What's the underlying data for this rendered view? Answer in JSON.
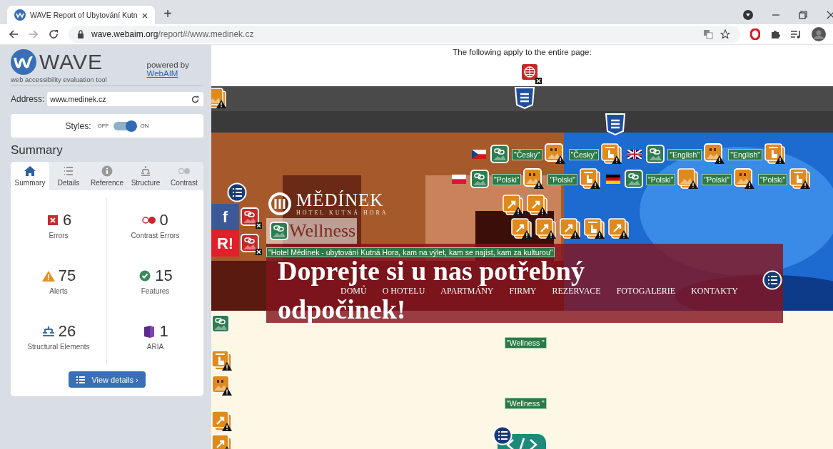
{
  "browser": {
    "tab": {
      "title": "WAVE Report of Ubytování Kutn",
      "close": "×"
    },
    "new_tab": "+",
    "url": {
      "host": "wave.webaim.org",
      "path": "/report#/www.medinek.cz"
    }
  },
  "sidebar": {
    "logo": "WAVE",
    "tagline": "web accessibility evaluation tool",
    "powered_by": "powered by",
    "powered_link": "WebAIM",
    "address_label": "Address:",
    "address_value": "www.medinek.cz",
    "styles": {
      "label": "Styles:",
      "off": "OFF",
      "on_label": "ON",
      "on": true
    },
    "summary_title": "Summary",
    "tabs": [
      {
        "label": "Summary",
        "kind": "home",
        "selected": true
      },
      {
        "label": "Details",
        "kind": "list",
        "selected": false
      },
      {
        "label": "Reference",
        "kind": "info",
        "selected": false
      },
      {
        "label": "Structure",
        "kind": "tree",
        "selected": false
      },
      {
        "label": "Contrast",
        "kind": "contrast",
        "selected": false
      }
    ],
    "stats": [
      {
        "kind": "errors",
        "count": "6",
        "label": "Errors"
      },
      {
        "kind": "contrast",
        "count": "0",
        "label": "Contrast Errors"
      },
      {
        "kind": "alerts",
        "count": "75",
        "label": "Alerts"
      },
      {
        "kind": "features",
        "count": "15",
        "label": "Features"
      },
      {
        "kind": "structure",
        "count": "26",
        "label": "Structural Elements"
      },
      {
        "kind": "aria",
        "count": "1",
        "label": "ARIA"
      }
    ],
    "view_details": "View details ›"
  },
  "page": {
    "notice": "The following apply to the entire page:",
    "page_markers": [
      {
        "kind": "error-language"
      }
    ],
    "strip_markers": [
      {
        "kind": "alert-image"
      },
      {
        "kind": "landmark"
      }
    ],
    "hero_markers": [
      {
        "kind": "landmark"
      },
      {
        "kind": "list"
      },
      {
        "kind": "error-link"
      },
      {
        "kind": "error-link"
      },
      {
        "kind": "list"
      }
    ],
    "social": [
      {
        "kind": "facebook",
        "text": "f"
      },
      {
        "kind": "rating",
        "text": "R!"
      }
    ],
    "logo": {
      "name": "MĚDÍNEK",
      "subtitle": "HOTEL KUTNÁ HORA"
    },
    "wellness": {
      "text": "Wellness",
      "marker": {
        "kind": "feature"
      }
    },
    "alt_label": "\"Hotel Mědínek - ubytování Kutná Hora, kam na výlet, kam se najíst, kam za kulturou\"",
    "heading": [
      "Doprejte si u nas potřebný",
      "odpočinek!"
    ],
    "nav": [
      "DOMŮ",
      "O HOTELU",
      "APARTMÁNY",
      "FIRMY",
      "REZERVACE",
      "FOTOGALERIE",
      "KONTAKTY"
    ],
    "marker_rows": [
      [
        {
          "kind": "flag-cz"
        },
        {
          "kind": "feature"
        },
        {
          "kind": "label",
          "text": "\"Česky\""
        },
        {
          "kind": "alert-alt"
        },
        {
          "kind": "label",
          "text": "\"Česky\""
        },
        {
          "kind": "alert-press"
        },
        {
          "kind": "flag-gb"
        },
        {
          "kind": "feature"
        },
        {
          "kind": "label",
          "text": "\"English\""
        },
        {
          "kind": "alert-alt"
        },
        {
          "kind": "label",
          "text": "\"English\""
        },
        {
          "kind": "alert-press"
        }
      ],
      [
        {
          "kind": "flag-pl"
        },
        {
          "kind": "feature"
        },
        {
          "kind": "label",
          "text": "\"Polski\""
        },
        {
          "kind": "alert-alt"
        },
        {
          "kind": "label",
          "text": "\"Polski\""
        },
        {
          "kind": "alert-press"
        },
        {
          "kind": "flag-de"
        },
        {
          "kind": "feature"
        },
        {
          "kind": "label",
          "text": "\"Polski\""
        },
        {
          "kind": "alert-image"
        },
        {
          "kind": "label",
          "text": "\"Polski\""
        },
        {
          "kind": "alert-alt"
        },
        {
          "kind": "label",
          "text": "\"Polski\""
        },
        {
          "kind": "alert-press"
        }
      ],
      [
        {
          "kind": "alert-redirect"
        },
        {
          "kind": "alert-redirect"
        }
      ],
      [
        {
          "kind": "alert-redirect"
        },
        {
          "kind": "alert-redirect"
        },
        {
          "kind": "alert-redirect"
        },
        {
          "kind": "alert-press"
        },
        {
          "kind": "alert-redirect"
        }
      ]
    ],
    "lower_markers": [
      {
        "kind": "feature"
      },
      {
        "kind": "alert-press"
      },
      {
        "kind": "alert-alt"
      },
      {
        "kind": "alert-redirect"
      },
      {
        "kind": "alert-redirect"
      },
      {
        "kind": "label",
        "text": "\"Wellness \""
      },
      {
        "kind": "label",
        "text": "\"Wellness \""
      },
      {
        "kind": "code"
      },
      {
        "kind": "list"
      }
    ]
  }
}
